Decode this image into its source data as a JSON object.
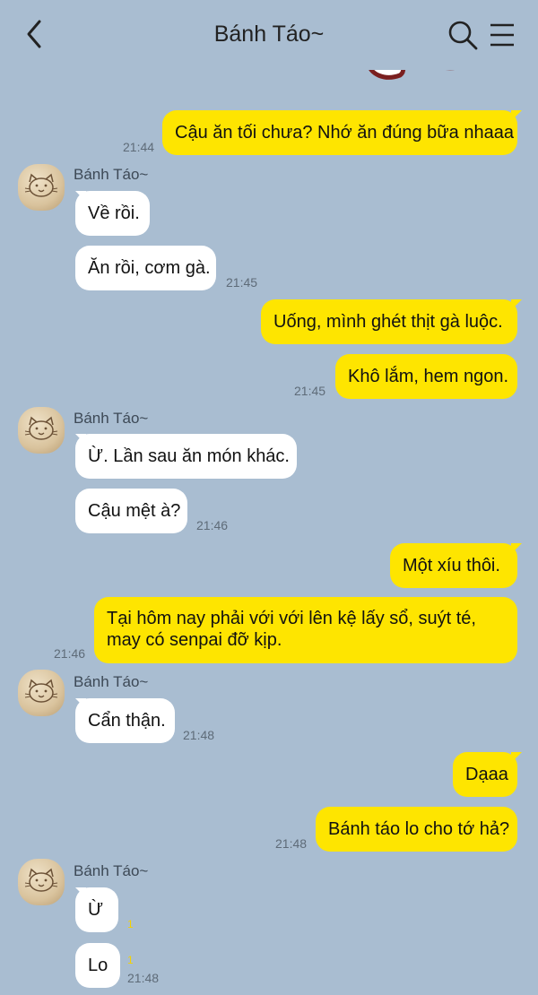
{
  "header": {
    "title": "Bánh Táo~"
  },
  "contact": {
    "name": "Bánh Táo~"
  },
  "messages": {
    "m1": {
      "text": "Cậu ăn tối chưa? Nhớ ăn đúng bữa nhaaa",
      "time": "21:44"
    },
    "m2": {
      "text": "Về rồi."
    },
    "m3": {
      "text": "Ăn rồi, cơm gà.",
      "time": "21:45"
    },
    "m4": {
      "text": "Uống, mình ghét thịt gà luộc."
    },
    "m5": {
      "text": "Khô lắm, hem ngon.",
      "time": "21:45"
    },
    "m6": {
      "text": "Ừ. Lần sau ăn món khác."
    },
    "m7": {
      "text": "Cậu mệt à?",
      "time": "21:46"
    },
    "m8": {
      "text": "Một xíu thôi."
    },
    "m9": {
      "text": "Tại hôm nay phải với với lên kệ lấy sổ, suýt té, may có senpai đỡ kịp.",
      "time": "21:46"
    },
    "m10": {
      "text": "Cẩn thận.",
      "time": "21:48"
    },
    "m11": {
      "text": "Dạaa"
    },
    "m12": {
      "text": "Bánh táo lo cho tớ hả?",
      "time": "21:48"
    },
    "m13": {
      "text": "Ừ",
      "unread": "1"
    },
    "m14": {
      "text": "Lo",
      "unread": "1",
      "time": "21:48"
    }
  },
  "colors": {
    "background": "#a9bdd1",
    "my_bubble": "#fee500",
    "their_bubble": "#ffffff"
  },
  "icons": [
    "back-icon",
    "search-icon",
    "menu-icon"
  ]
}
